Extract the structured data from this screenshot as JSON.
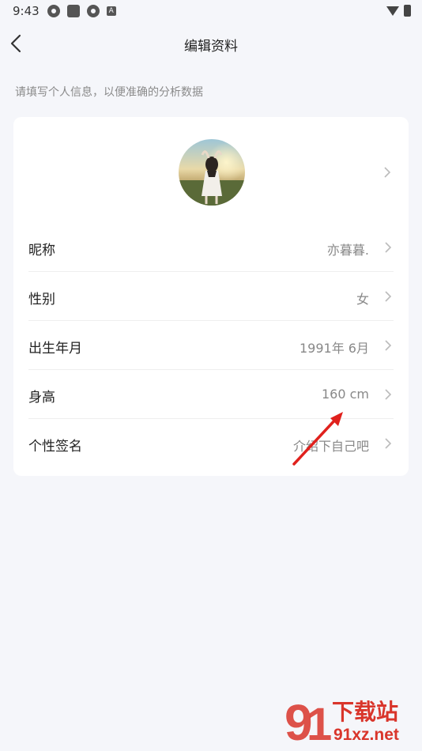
{
  "status_bar": {
    "time": "9:43",
    "notif_letter": "A"
  },
  "header": {
    "title": "编辑资料"
  },
  "hint": "请填写个人信息，以便准确的分析数据",
  "profile_rows": [
    {
      "label": "昵称",
      "value": "亦暮暮."
    },
    {
      "label": "性别",
      "value": "女"
    },
    {
      "label": "出生年月",
      "value": "1991年 6月"
    },
    {
      "label": "身高",
      "value": "160 cm"
    },
    {
      "label": "个性签名",
      "value": "介绍下自己吧"
    }
  ],
  "watermark": {
    "main": "下载站",
    "sub": "91xz.net"
  },
  "colors": {
    "background": "#f5f6fa",
    "card": "#ffffff",
    "annotation_arrow": "#e0211d",
    "watermark": "#d9352b"
  },
  "icons": [
    "chevron-left-icon",
    "chevron-right-icon",
    "wifi-icon",
    "battery-icon"
  ]
}
